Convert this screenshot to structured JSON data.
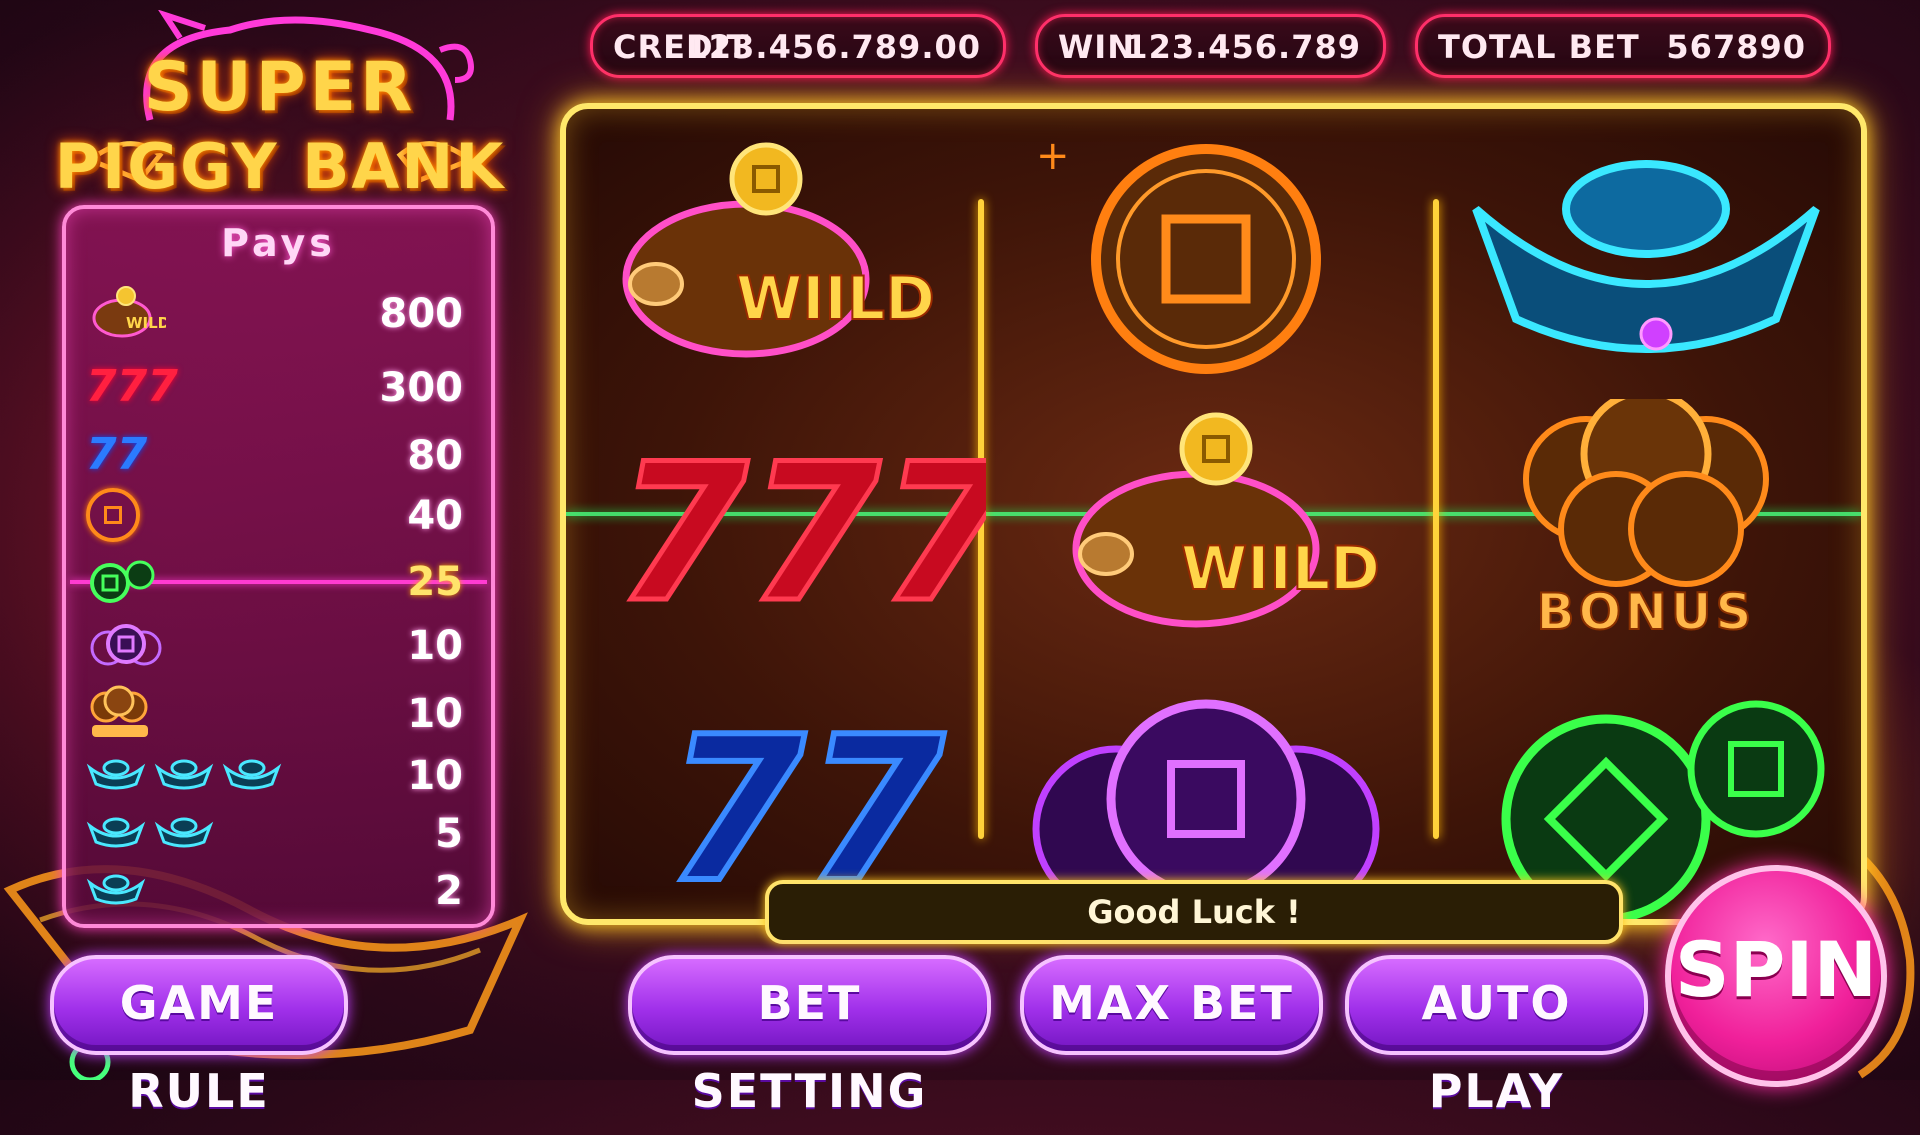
{
  "logo": {
    "line1": "SUPER",
    "line2": "PIGGY BANK"
  },
  "stats": {
    "credit_label": "CREDIT",
    "credit_value": "123.456.789.00",
    "win_label": "WIN",
    "win_value": "123.456.789",
    "bet_label": "TOTAL BET",
    "bet_value": "567890"
  },
  "paytable": {
    "title": "Pays",
    "rows": [
      {
        "symbol": "wild-pig-icon",
        "amount": "800"
      },
      {
        "symbol": "red-triple-seven-icon",
        "amount": "300"
      },
      {
        "symbol": "blue-double-seven-icon",
        "amount": "80"
      },
      {
        "symbol": "orange-coin-icon",
        "amount": "40"
      },
      {
        "symbol": "green-coins-icon",
        "amount": "25"
      },
      {
        "symbol": "purple-coins-icon",
        "amount": "10"
      },
      {
        "symbol": "bonus-coins-icon",
        "amount": "10"
      },
      {
        "symbol": "three-ingots-icon",
        "amount": "10"
      },
      {
        "symbol": "two-ingots-icon",
        "amount": "5"
      },
      {
        "symbol": "one-ingot-icon",
        "amount": "2"
      }
    ]
  },
  "reels": {
    "wild_text": "WIILD",
    "bonus_text": "BONUS"
  },
  "message": "Good Luck !",
  "buttons": {
    "game_rule": "GAME RULE",
    "bet_setting": "BET SETTING",
    "max_bet": "MAX BET",
    "auto_play": "AUTO PLAY",
    "spin": "SPIN"
  },
  "colors": {
    "frame": "#ffe86a",
    "paytable_border": "#ff8ad8",
    "button": "#a030ea",
    "spin": "#f0209a",
    "payline": "#46ff7c"
  }
}
